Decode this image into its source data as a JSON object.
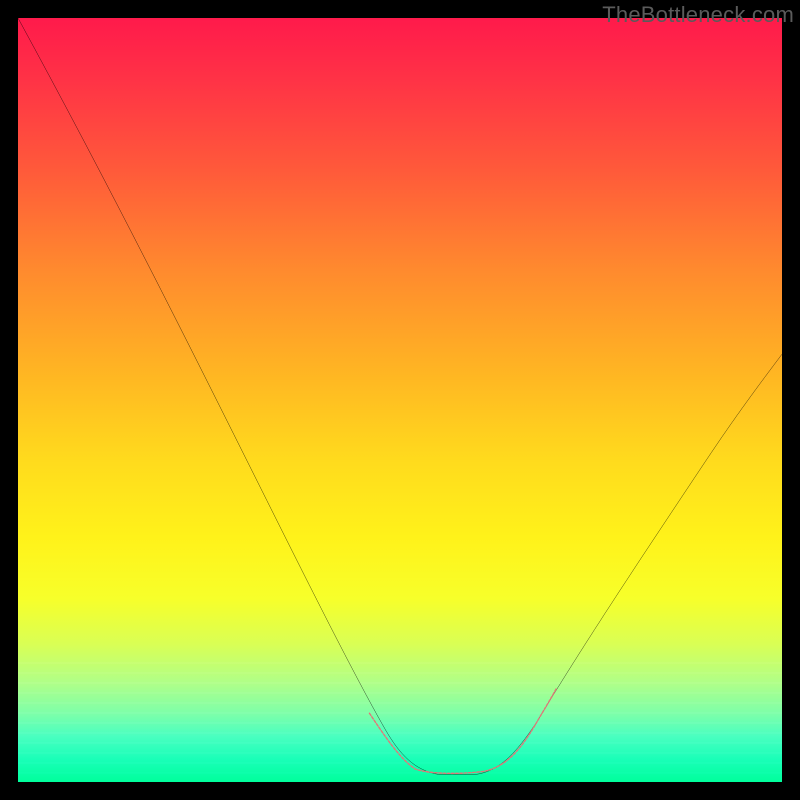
{
  "watermark": {
    "text": "TheBottleneck.com"
  },
  "chart_data": {
    "type": "line",
    "title": "",
    "xlabel": "",
    "ylabel": "",
    "xlim": [
      0,
      100
    ],
    "ylim": [
      0,
      100
    ],
    "grid": false,
    "legend": false,
    "background": {
      "kind": "vertical-gradient",
      "stops": [
        {
          "pos": 0,
          "color": "#ff1a4b"
        },
        {
          "pos": 20,
          "color": "#ff5a3a"
        },
        {
          "pos": 46,
          "color": "#ffb423"
        },
        {
          "pos": 68,
          "color": "#fff21a"
        },
        {
          "pos": 88,
          "color": "#9cff92"
        },
        {
          "pos": 100,
          "color": "#00ff9c"
        }
      ]
    },
    "series": [
      {
        "name": "bottleneck-curve",
        "color": "#000000",
        "x": [
          0,
          5,
          10,
          15,
          20,
          25,
          30,
          35,
          40,
          45,
          48,
          50,
          54,
          58,
          62,
          64,
          66,
          70,
          75,
          80,
          85,
          90,
          95,
          100
        ],
        "y": [
          100,
          90,
          80,
          70,
          60,
          50,
          41,
          32,
          23,
          13,
          7,
          3,
          1,
          1,
          1,
          2,
          4,
          9,
          16,
          24,
          32,
          41,
          49,
          56
        ]
      }
    ],
    "markers": {
      "name": "flat-region-markers",
      "color": "#e07878",
      "points": [
        {
          "x": 46,
          "y": 9
        },
        {
          "x": 49,
          "y": 4
        },
        {
          "x": 51,
          "y": 2
        },
        {
          "x": 54,
          "y": 1
        },
        {
          "x": 57,
          "y": 1
        },
        {
          "x": 60,
          "y": 1
        },
        {
          "x": 63,
          "y": 2
        },
        {
          "x": 66,
          "y": 5
        },
        {
          "x": 68,
          "y": 8
        },
        {
          "x": 70,
          "y": 11
        }
      ]
    }
  }
}
